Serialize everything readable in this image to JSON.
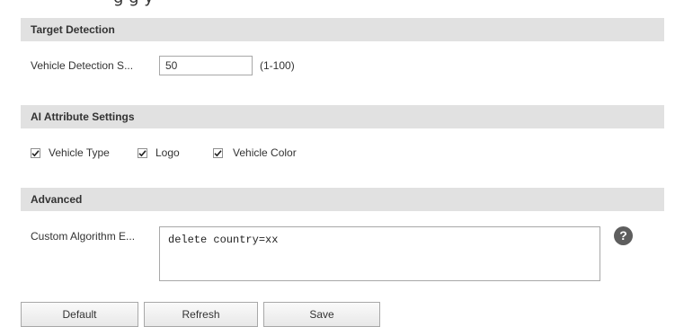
{
  "top_caption": "g   g  y",
  "sections": {
    "target_detection": {
      "title": "Target Detection",
      "field_label": "Vehicle Detection S...",
      "field_value": "50",
      "field_range": "(1-100)"
    },
    "ai_attribute": {
      "title": "AI Attribute Settings",
      "options": [
        {
          "label": "Vehicle Type",
          "checked": true
        },
        {
          "label": "Logo",
          "checked": true
        },
        {
          "label": "Vehicle Color",
          "checked": true
        }
      ]
    },
    "advanced": {
      "title": "Advanced",
      "field_label": "Custom Algorithm E...",
      "field_value": "delete country=xx",
      "help_icon": "question-circle-icon",
      "help_glyph": "?"
    }
  },
  "buttons": {
    "default": "Default",
    "refresh": "Refresh",
    "save": "Save"
  },
  "colors": {
    "section_header_bg": "#e1e1e1",
    "help_icon_bg": "#5e5e5e",
    "text": "#333333"
  }
}
